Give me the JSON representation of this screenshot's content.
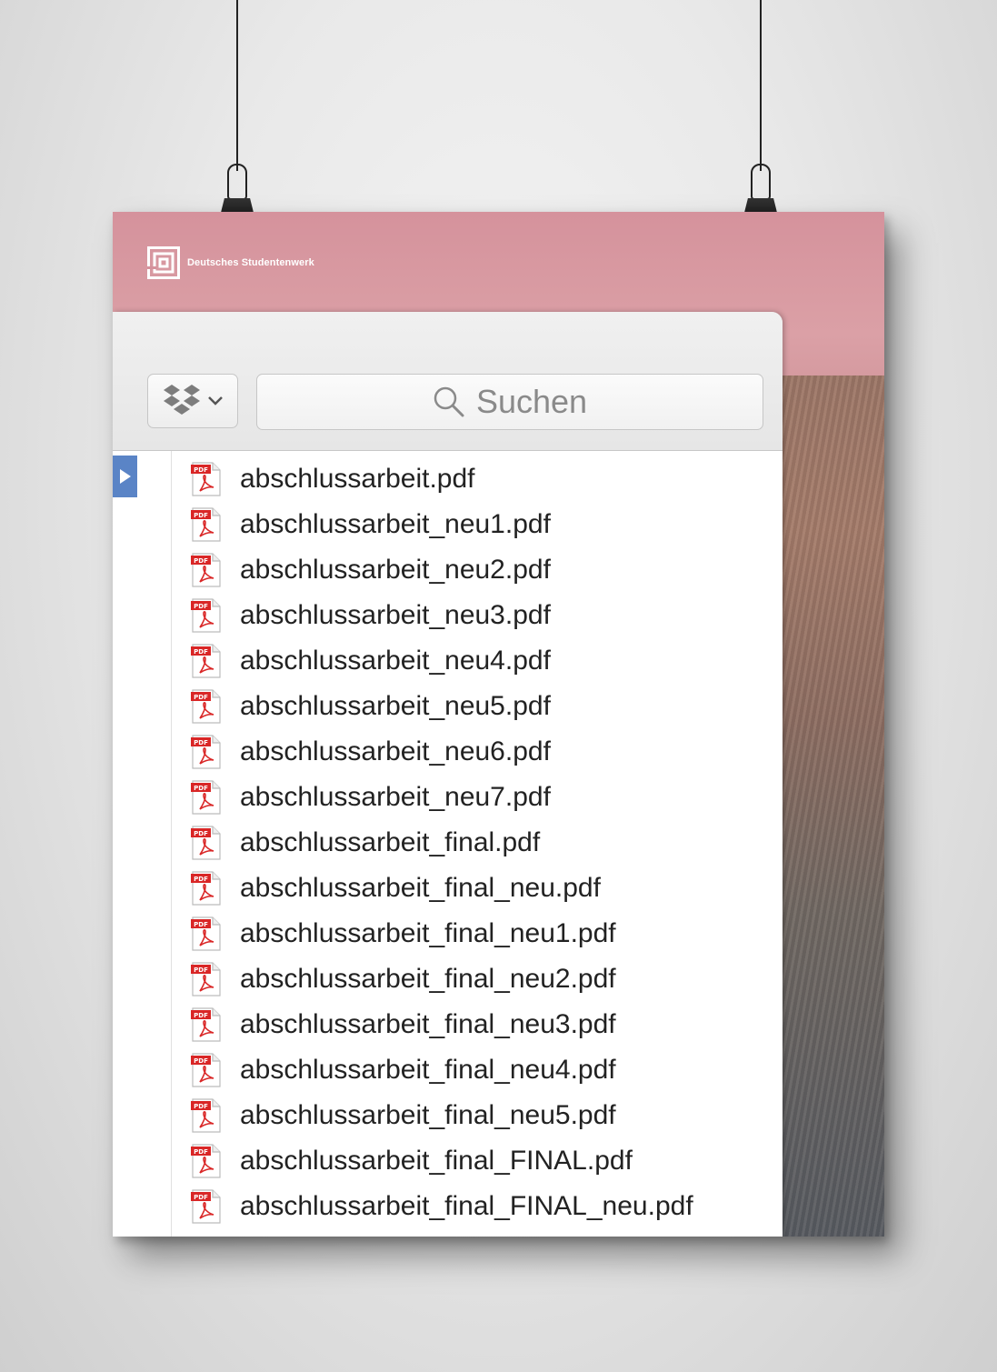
{
  "brand": {
    "logo_text": "Deutsches Studentenwerk"
  },
  "toolbar": {
    "dropbox_icon": "dropbox-icon",
    "search_placeholder": "Suchen"
  },
  "files": [
    "abschlussarbeit.pdf",
    "abschlussarbeit_neu1.pdf",
    "abschlussarbeit_neu2.pdf",
    "abschlussarbeit_neu3.pdf",
    "abschlussarbeit_neu4.pdf",
    "abschlussarbeit_neu5.pdf",
    "abschlussarbeit_neu6.pdf",
    "abschlussarbeit_neu7.pdf",
    "abschlussarbeit_final.pdf",
    "abschlussarbeit_final_neu.pdf",
    "abschlussarbeit_final_neu1.pdf",
    "abschlussarbeit_final_neu2.pdf",
    "abschlussarbeit_final_neu3.pdf",
    "abschlussarbeit_final_neu4.pdf",
    "abschlussarbeit_final_neu5.pdf",
    "abschlussarbeit_final_FINAL.pdf",
    "abschlussarbeit_final_FINAL_neu.pdf"
  ],
  "file_icon": "pdf-icon",
  "colors": {
    "selection_blue": "#5a84c6",
    "pdf_red": "#d92626"
  }
}
